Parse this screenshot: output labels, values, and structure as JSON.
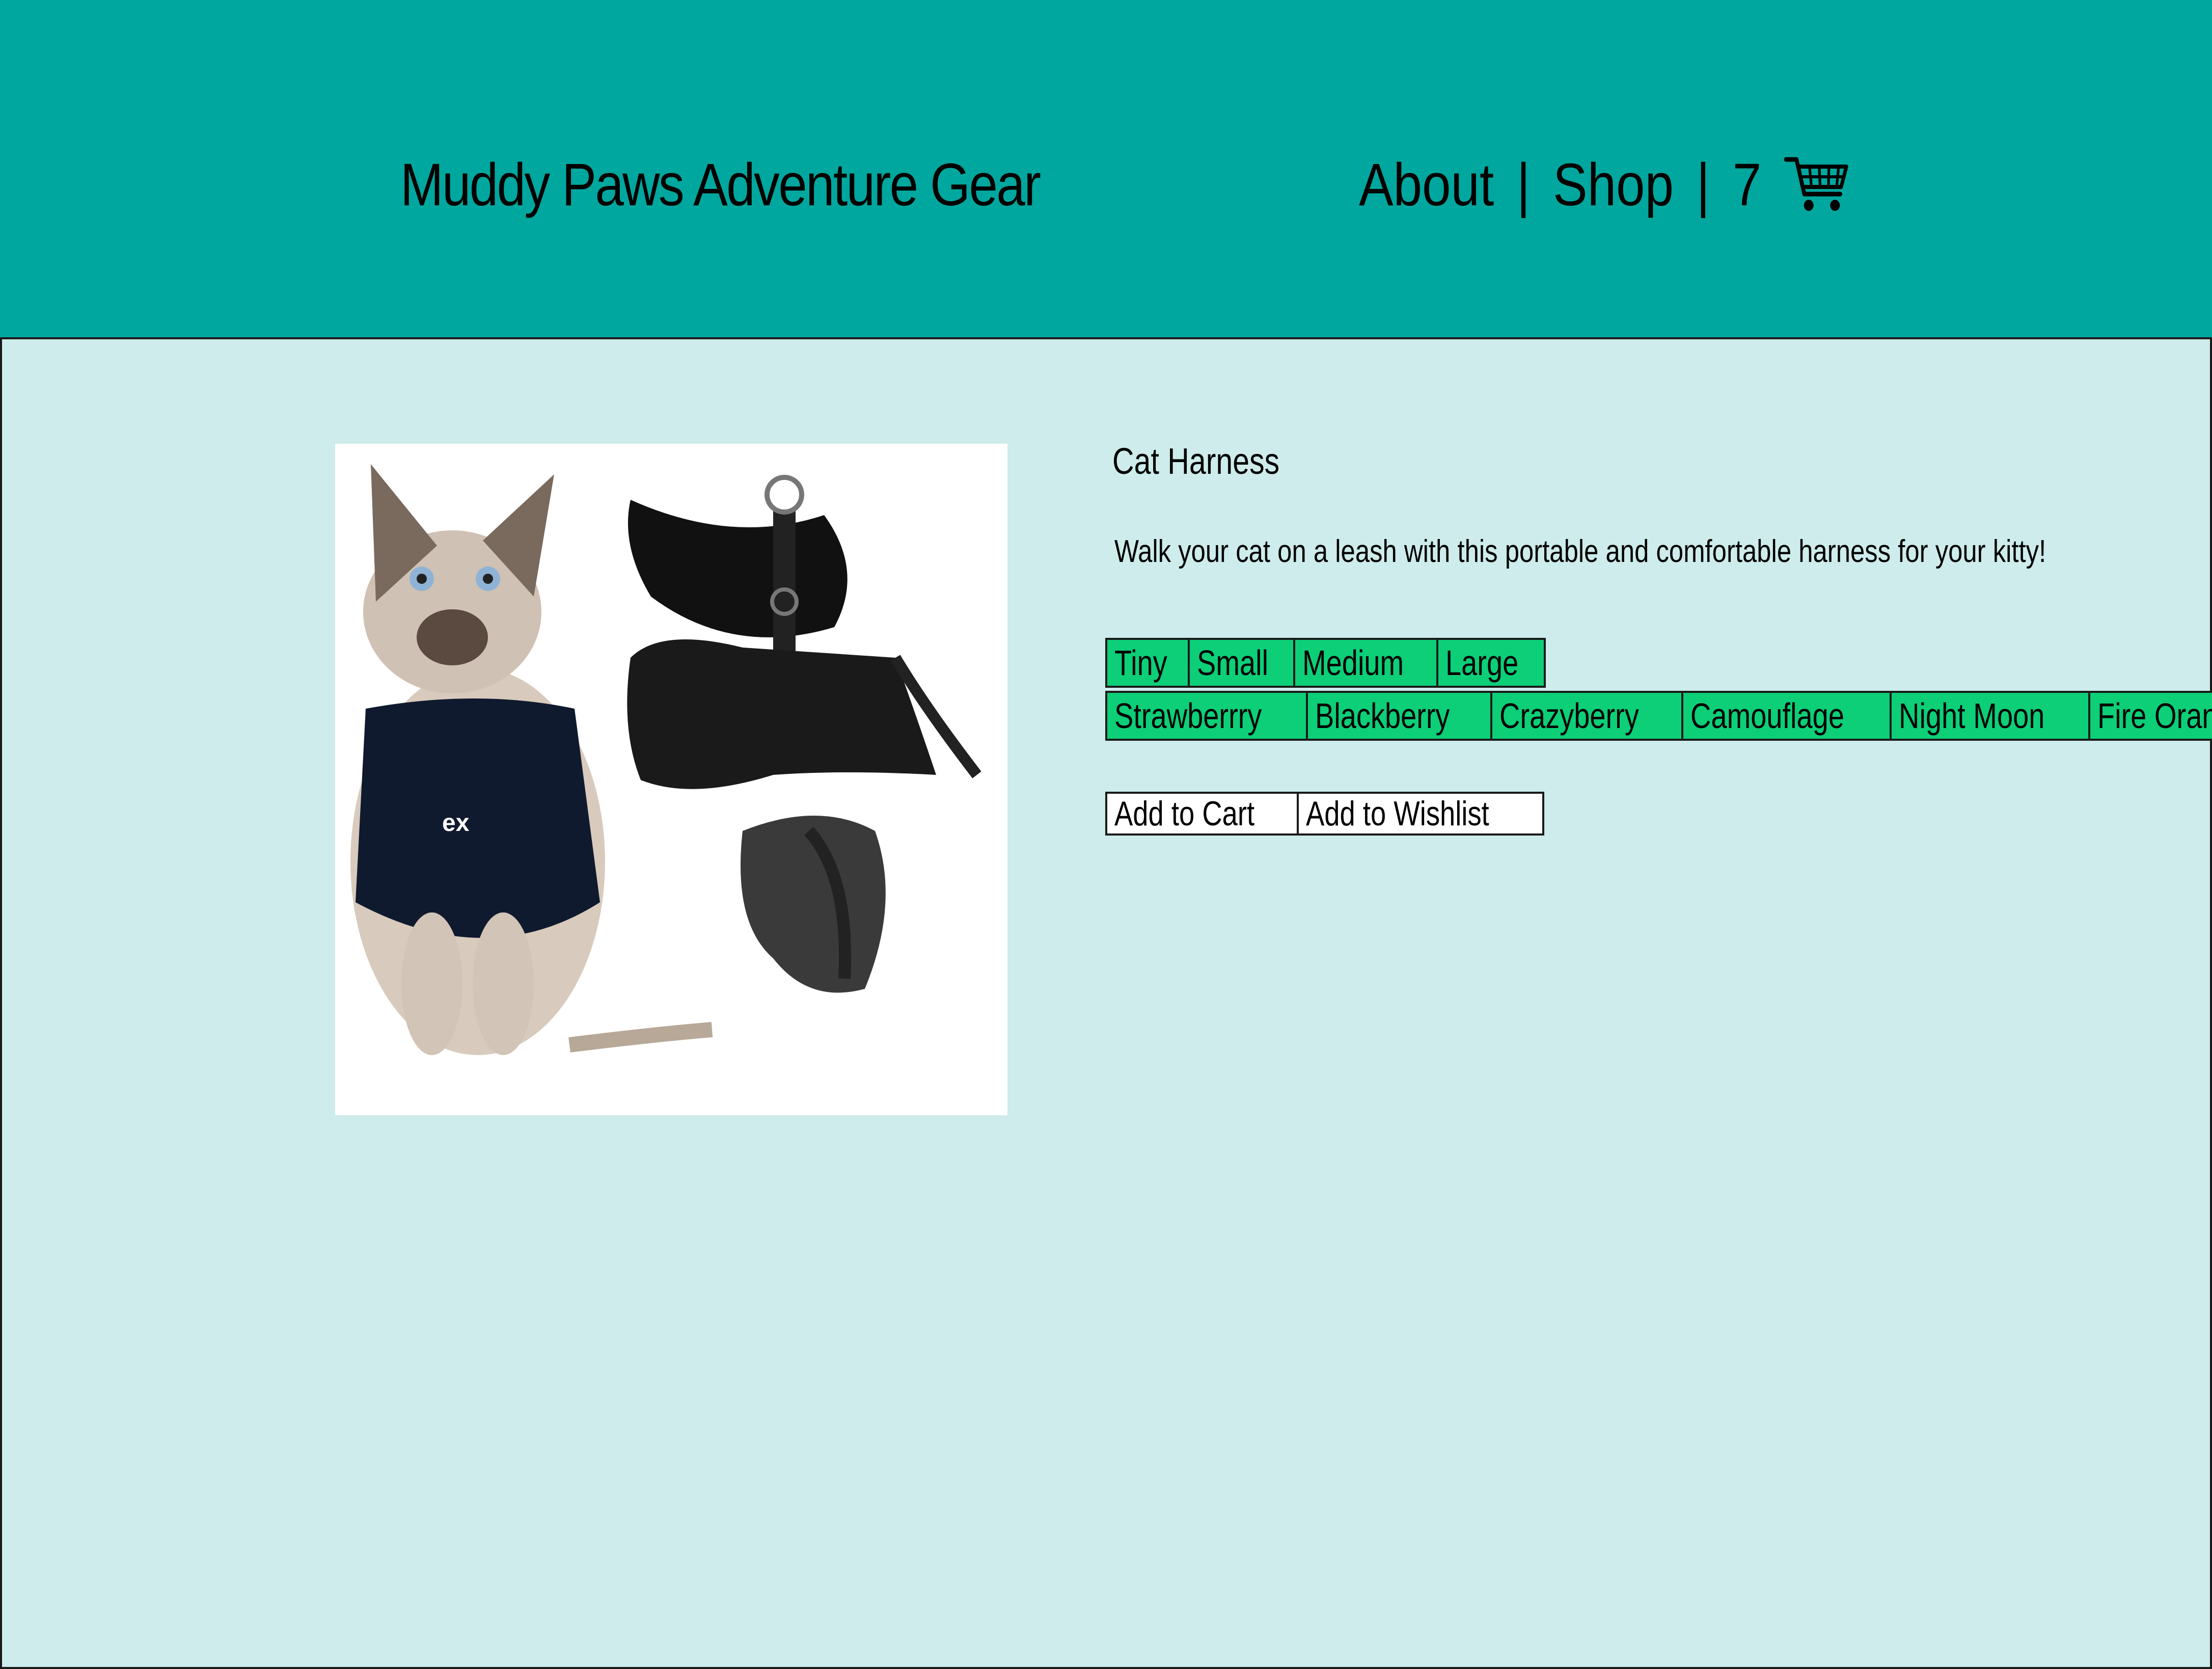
{
  "header": {
    "site_title": "Muddy Paws Adventure Gear",
    "nav": {
      "about_label": "About",
      "separator": "|",
      "shop_label": "Shop",
      "cart_count": "7",
      "cart_icon": "shopping-cart-icon"
    }
  },
  "product": {
    "title": "Cat Harness",
    "description": "Walk your cat on a leash with this portable and comfortable harness for your kitty!",
    "image_alt": "cat-harness-product-image",
    "sizes": [
      "Tiny",
      "Small",
      "Medium",
      "Large"
    ],
    "colors": [
      "Strawberrry",
      "Blackberry",
      "Crazyberry",
      "Camouflage",
      "Night Moon",
      "Fire Orange"
    ],
    "actions": {
      "add_to_cart_label": "Add to Cart",
      "add_to_wishlist_label": "Add to Wishlist"
    }
  },
  "colors": {
    "header_bg": "#00a79e",
    "page_bg": "#cdeceb",
    "option_bg": "#0ccf78",
    "button_bg": "#ffffff"
  }
}
